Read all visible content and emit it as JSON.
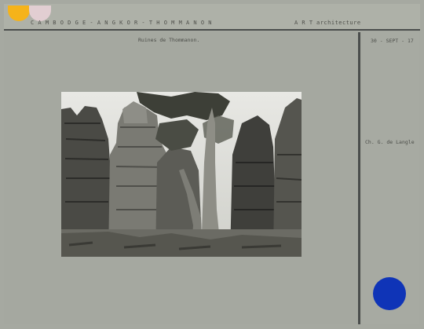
{
  "header": {
    "location": "C A M B O D G E  -  A N G K O R  -  T H O M M A N O N",
    "category_code": "A R T",
    "category": "architecture"
  },
  "caption": "Ruines de Thommanon.",
  "date_label": "30 - SEPT - 17",
  "author": "Ch. G. de Langle",
  "colors": {
    "accent_yellow": "#f5b31a",
    "accent_blue": "#0f34b7",
    "card": "#a6a9a1"
  }
}
